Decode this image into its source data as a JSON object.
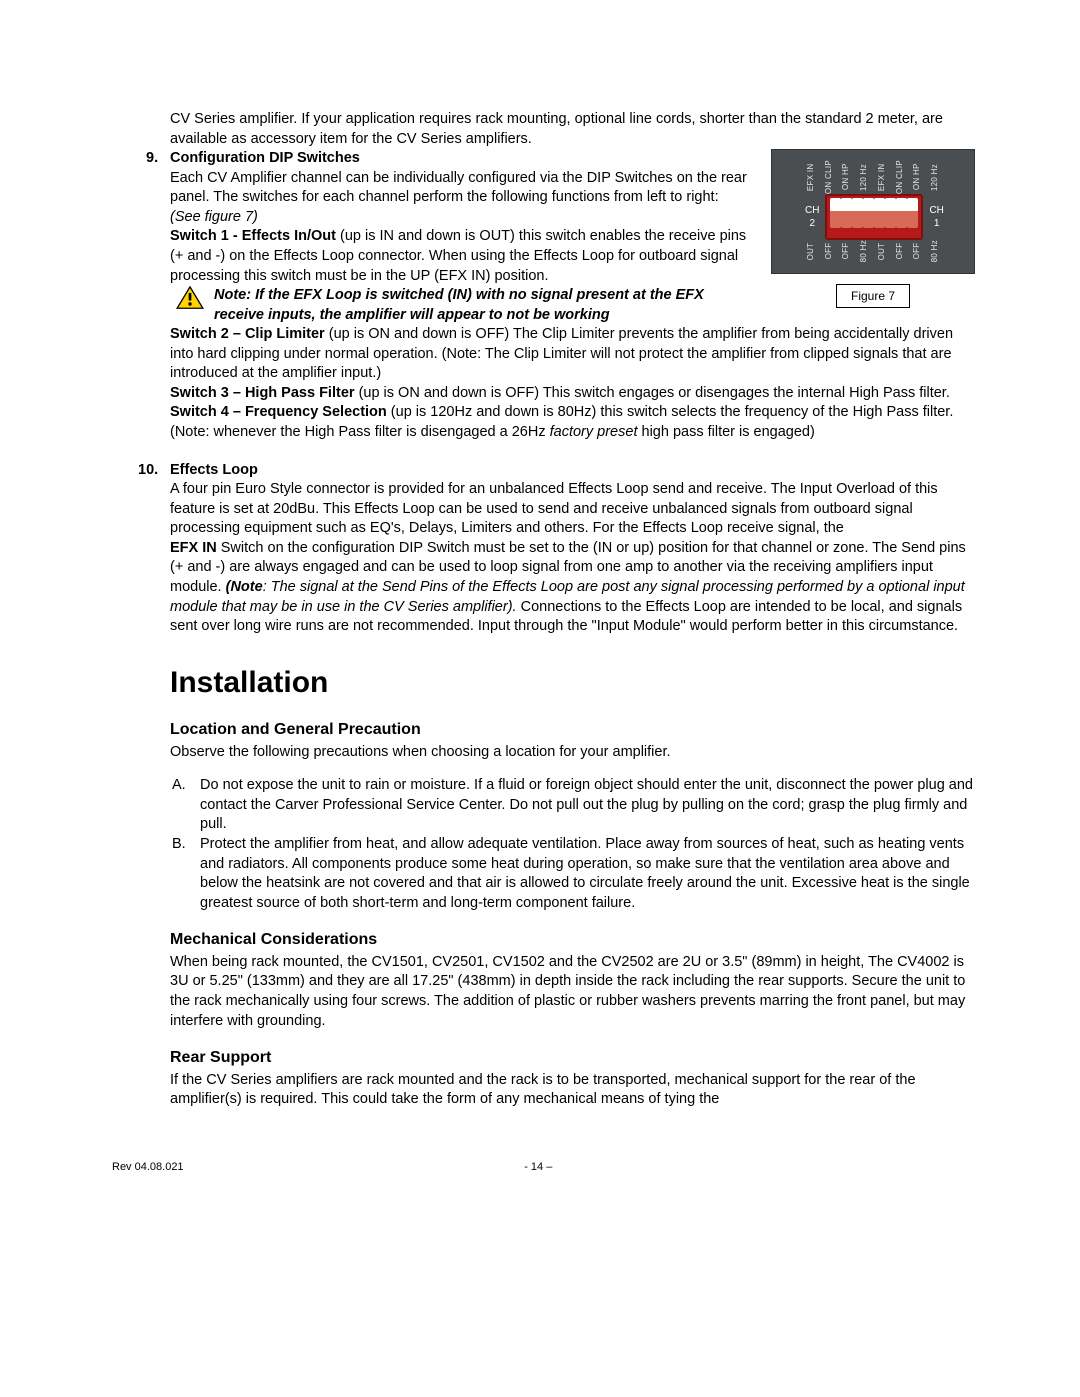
{
  "intro": "CV Series amplifier.  If your application requires rack mounting, optional line cords, shorter than the standard 2 meter, are available as accessory item for the CV Series amplifiers.",
  "sec9": {
    "num": "9.",
    "title": "Configuration DIP Switches",
    "p1": "Each CV Amplifier channel can be individually configured via the DIP Switches on the rear panel.  The switches for each channel perform the following functions from left to right:  ",
    "p1_ital": "(See figure 7)",
    "sw1a": "Switch 1 - Effects In/Out",
    "sw1b": " (up is IN and down is OUT) this switch enables the receive pins (+ and -) on the Effects Loop connector.  When using the Effects Loop for outboard signal processing this switch must be in the UP (EFX IN) position.",
    "note_label": "Note:",
    "note_text": "  If the EFX Loop is switched (IN) with no signal present at the EFX receive inputs, the amplifier will appear to not be working",
    "sw2a": "Switch 2 – Clip Limiter",
    "sw2b": " (up is ON and down is OFF) The Clip Limiter prevents the amplifier from being accidentally driven into hard clipping under normal operation.  (Note: The Clip Limiter will not protect the amplifier from clipped signals that are introduced at the amplifier input.)",
    "sw3a": "Switch 3 – High Pass Filter",
    "sw3b": " (up is ON and down is OFF) This switch engages or disengages the internal High Pass filter.",
    "sw4a": "Switch 4 – Frequency Selection",
    "sw4b1": " (up is 120Hz and down is 80Hz) this switch selects the frequency of the High Pass filter.  (Note: whenever the High Pass filter is disengaged a 26Hz ",
    "sw4b2": "factory preset",
    "sw4b3": " high pass filter is engaged)"
  },
  "sec10": {
    "num": "10.",
    "title": "Effects Loop",
    "p1": "A four pin Euro Style connector is provided for an unbalanced Effects Loop send and receive.  The Input Overload of this feature is set at 20dBu.  This Effects Loop can be used to send and receive unbalanced signals from outboard signal processing equipment such as EQ's, Delays, Limiters and others.  For the Effects Loop receive signal, the",
    "efx_bold": "EFX IN",
    "p2a": " Switch on the configuration DIP Switch must be set to the (IN or up) position for that channel or zone.  The Send pins (+ and -) are always engaged and can be used to loop signal from one amp to another via the receiving amplifiers input module. ",
    "p2_note_b": "(Note",
    "p2_note_i": ": The signal at the Send Pins of the Effects Loop are post any signal processing performed by a optional input module that may be in use in the CV Series amplifier).",
    "p2c": " Connections to the Effects Loop are intended to be local, and signals sent over long wire runs are not recommended.  Input through the \"Input Module\" would perform better in this circumstance."
  },
  "install": {
    "h1": "Installation",
    "loc_h": "Location and General Precaution",
    "loc_p": "Observe the following precautions when choosing a location for your amplifier.",
    "a_letter": "A.",
    "a": "Do not expose the unit to rain or moisture.  If a fluid or foreign object should enter the unit, disconnect the power plug and contact the Carver Professional Service Center.  Do not pull out the plug by pulling on the cord; grasp the plug firmly and pull.",
    "b_letter": "B.",
    "b": "Protect the amplifier from heat, and allow adequate ventilation.  Place away from sources of heat, such as heating vents and radiators.  All components produce some heat during operation, so make sure that the ventilation area above and below the heatsink are not covered and that air is allowed to circulate freely around the unit.  Excessive heat is the single greatest source of both short-term and long-term component failure.",
    "mech_h": "Mechanical Considerations",
    "mech_p": "When being rack mounted, the CV1501, CV2501, CV1502 and the CV2502 are 2U or 3.5\" (89mm) in height, The CV4002 is 3U or 5.25\" (133mm) and they are all 17.25\" (438mm) in depth inside the rack including the rear supports.  Secure the unit to the rack mechanically using four screws.  The addition of plastic or rubber washers prevents marring the front panel, but may interfere with grounding.",
    "rear_h": "Rear Support",
    "rear_p": "If the CV Series amplifiers are rack mounted and the rack is to be transported, mechanical support for the rear of the amplifier(s) is required.  This could take the form of any mechanical means of tying the"
  },
  "figure": {
    "caption": "Figure 7",
    "ch2": "CH 2",
    "ch1": "CH 1",
    "top": [
      "EFX IN",
      "ON CLIP",
      "ON HP",
      "120 Hz",
      "EFX IN",
      "ON CLIP",
      "ON HP",
      "120 Hz"
    ],
    "bot": [
      "OUT",
      "OFF",
      "OFF",
      "80 Hz",
      "OUT",
      "OFF",
      "OFF",
      "80 Hz"
    ]
  },
  "footer": {
    "left": "Rev 04.08.021",
    "mid": "- 14 –"
  }
}
